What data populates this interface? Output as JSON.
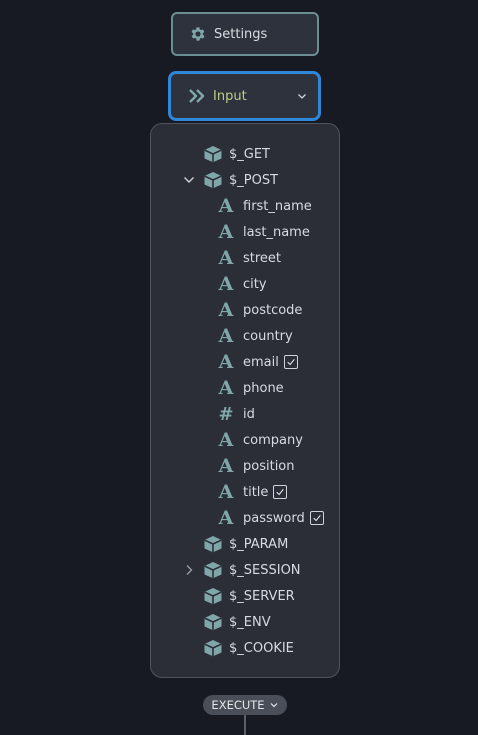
{
  "settings": {
    "label": "Settings",
    "icon": "gear-icon"
  },
  "input": {
    "label": "Input",
    "icon": "double-chevron-right-icon",
    "dropdown_icon": "chevron-down-icon"
  },
  "tree": {
    "get": {
      "label": "$_GET",
      "icon": "cube-icon"
    },
    "post": {
      "label": "$_POST",
      "icon": "cube-icon",
      "expanded": true,
      "fields": [
        {
          "label": "first_name",
          "type": "text"
        },
        {
          "label": "last_name",
          "type": "text"
        },
        {
          "label": "street",
          "type": "text"
        },
        {
          "label": "city",
          "type": "text"
        },
        {
          "label": "postcode",
          "type": "text"
        },
        {
          "label": "country",
          "type": "text"
        },
        {
          "label": "email",
          "type": "text",
          "checked": true
        },
        {
          "label": "phone",
          "type": "text"
        },
        {
          "label": "id",
          "type": "number"
        },
        {
          "label": "company",
          "type": "text"
        },
        {
          "label": "position",
          "type": "text"
        },
        {
          "label": "title",
          "type": "text",
          "checked": true
        },
        {
          "label": "password",
          "type": "text",
          "checked": true
        }
      ]
    },
    "param": {
      "label": "$_PARAM",
      "icon": "cube-icon"
    },
    "session": {
      "label": "$_SESSION",
      "icon": "cube-icon",
      "expanded": false
    },
    "server": {
      "label": "$_SERVER",
      "icon": "cube-icon"
    },
    "env": {
      "label": "$_ENV",
      "icon": "cube-icon"
    },
    "cookie": {
      "label": "$_COOKIE",
      "icon": "cube-icon"
    }
  },
  "execute": {
    "label": "EXECUTE"
  },
  "colors": {
    "accent": "#2f87d8",
    "icon": "#7fa7aa",
    "input_label": "#b9cf85",
    "background": "#171923",
    "panel": "#2b2e37"
  }
}
